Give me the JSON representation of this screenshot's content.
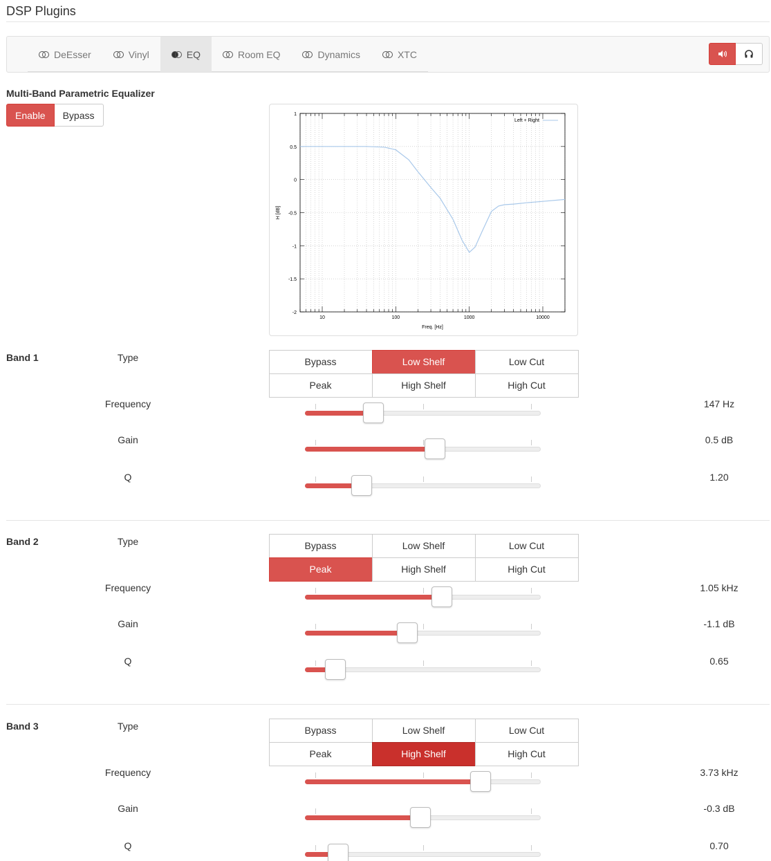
{
  "page": {
    "title": "DSP Plugins"
  },
  "tabs": [
    {
      "label": "DeEsser",
      "icon": "toggle-off-icon",
      "active": false
    },
    {
      "label": "Vinyl",
      "icon": "toggle-off-icon",
      "active": false
    },
    {
      "label": "EQ",
      "icon": "toggle-on-icon",
      "active": true
    },
    {
      "label": "Room EQ",
      "icon": "toggle-off-icon",
      "active": false
    },
    {
      "label": "Dynamics",
      "icon": "toggle-off-icon",
      "active": false
    },
    {
      "label": "XTC",
      "icon": "toggle-off-icon",
      "active": false
    }
  ],
  "outputs": {
    "speaker_icon": "speaker-icon",
    "headphones_icon": "headphones-icon",
    "active": "speaker"
  },
  "eq": {
    "title": "Multi-Band Parametric Equalizer",
    "enable_label": "Enable",
    "bypass_label": "Bypass",
    "state": "Enable"
  },
  "chart_data": {
    "type": "line",
    "xlabel": "Freq. [Hz]",
    "ylabel": "H [dB]",
    "x_scale": "log",
    "xlim": [
      5,
      20000
    ],
    "ylim": [
      -2,
      1
    ],
    "xticks": [
      "10",
      "100",
      "1000",
      "10000"
    ],
    "yticks": [
      "1",
      "0.5",
      "0",
      "-0.5",
      "-1",
      "-1.5",
      "-2"
    ],
    "grid": true,
    "legend": "top-right",
    "series": [
      {
        "name": "Left + Right",
        "color": "#a8c8ea",
        "x": [
          5,
          10,
          20,
          40,
          70,
          100,
          150,
          200,
          300,
          400,
          600,
          800,
          1000,
          1200,
          1500,
          2000,
          2500,
          3000,
          4000,
          6000,
          10000,
          20000
        ],
        "y": [
          0.5,
          0.5,
          0.5,
          0.5,
          0.49,
          0.45,
          0.3,
          0.12,
          -0.12,
          -0.28,
          -0.6,
          -0.92,
          -1.1,
          -1.02,
          -0.78,
          -0.48,
          -0.4,
          -0.38,
          -0.37,
          -0.35,
          -0.33,
          -0.3
        ]
      }
    ]
  },
  "type_options": [
    "Bypass",
    "Low Shelf",
    "Low Cut",
    "Peak",
    "High Shelf",
    "High Cut"
  ],
  "row_labels": {
    "type": "Type",
    "frequency": "Frequency",
    "gain": "Gain",
    "q": "Q"
  },
  "bands": [
    {
      "label": "Band 1",
      "type": "Low Shelf",
      "frequency": {
        "value": "147 Hz",
        "level": 0.29
      },
      "gain": {
        "value": "0.5 dB",
        "level": 0.55
      },
      "q": {
        "value": "1.20",
        "level": 0.24
      }
    },
    {
      "label": "Band 2",
      "type": "Peak",
      "frequency": {
        "value": "1.05 kHz",
        "level": 0.58
      },
      "gain": {
        "value": "-1.1 dB",
        "level": 0.435
      },
      "q": {
        "value": "0.65",
        "level": 0.13
      }
    },
    {
      "label": "Band 3",
      "type": "High Shelf",
      "frequency": {
        "value": "3.73 kHz",
        "level": 0.745
      },
      "gain": {
        "value": "-0.3 dB",
        "level": 0.49
      },
      "q": {
        "value": "0.70",
        "level": 0.14
      }
    }
  ]
}
